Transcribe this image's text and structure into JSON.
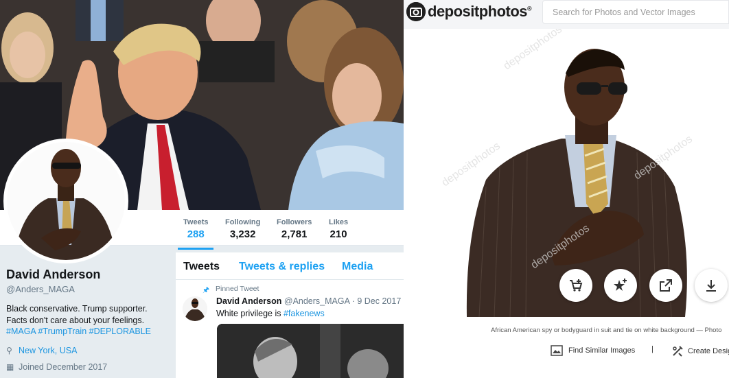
{
  "twitter": {
    "stats": [
      {
        "label": "Tweets",
        "value": "288"
      },
      {
        "label": "Following",
        "value": "3,232"
      },
      {
        "label": "Followers",
        "value": "2,781"
      },
      {
        "label": "Likes",
        "value": "210"
      }
    ],
    "profile": {
      "name": "David Anderson",
      "handle": "@Anders_MAGA",
      "bio_line1": "Black conservative. Trump supporter.",
      "bio_line2": "Facts don't care about your feelings.",
      "hashtags": "#MAGA #TrumpTrain #DEPLORABLE",
      "location": "New York, USA",
      "joined": "Joined December 2017"
    },
    "tabs": [
      "Tweets",
      "Tweets & replies",
      "Media"
    ],
    "pinned_label": "Pinned Tweet",
    "tweet": {
      "author": "David Anderson",
      "handle_date": "@Anders_MAGA · 9 Dec 2017",
      "text_prefix": "White privilege is ",
      "hashtag": "#fakenews"
    }
  },
  "depositphotos": {
    "logo": "depositphotos",
    "search_placeholder": "Search for Photos and Vector Images",
    "actions": [
      "add-to-cart-icon",
      "add-to-favorites-icon",
      "share-icon",
      "download-icon"
    ],
    "caption": "African American spy or bodyguard in suit and tie on white background — Photo",
    "find_similar": "Find Similar Images",
    "separator": "|",
    "create_design": "Create Design"
  }
}
